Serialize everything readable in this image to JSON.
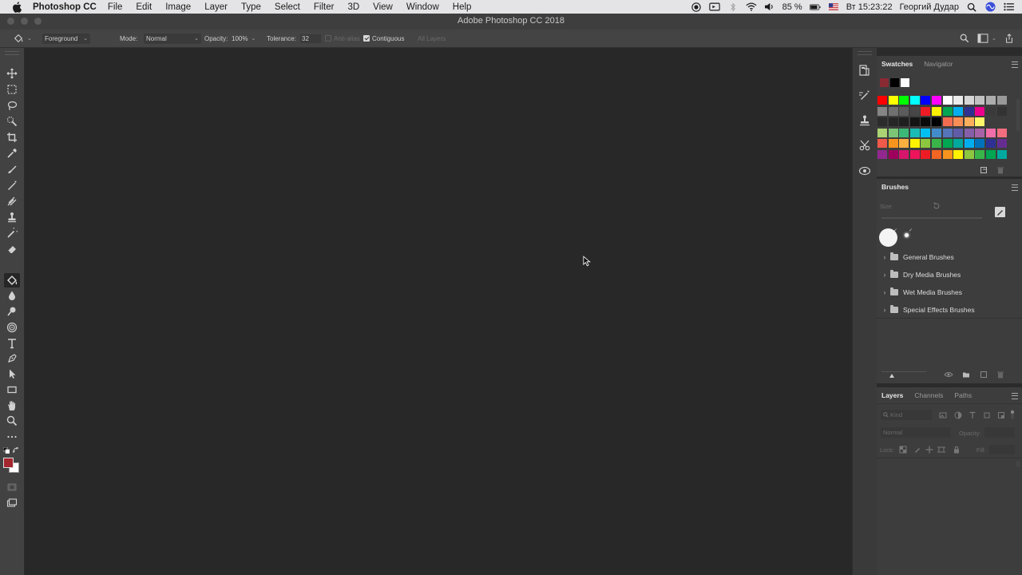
{
  "menubar": {
    "app_name": "Photoshop CC",
    "items": [
      "File",
      "Edit",
      "Image",
      "Layer",
      "Type",
      "Select",
      "Filter",
      "3D",
      "View",
      "Window",
      "Help"
    ],
    "battery": "85 %",
    "clock": "Вт 15:23:22",
    "user": "Георгий Дудар"
  },
  "window": {
    "title": "Adobe Photoshop CC 2018"
  },
  "options": {
    "fill_source": "Foreground",
    "mode_label": "Mode:",
    "mode_value": "Normal",
    "opacity_label": "Opacity:",
    "opacity_value": "100%",
    "tolerance_label": "Tolerance:",
    "tolerance_value": "32",
    "anti_alias_label": "Anti-alias",
    "anti_alias_checked": false,
    "contiguous_label": "Contiguous",
    "contiguous_checked": true,
    "all_layers_label": "All Layers"
  },
  "toolbar": {
    "tools": [
      {
        "name": "move-tool",
        "icon": "move-icon"
      },
      {
        "name": "marquee-tool",
        "icon": "rect-marquee-icon"
      },
      {
        "name": "lasso-tool",
        "icon": "lasso-icon"
      },
      {
        "name": "quick-selection-tool",
        "icon": "quick-select-icon"
      },
      {
        "name": "crop-tool",
        "icon": "crop-icon"
      },
      {
        "name": "eyedropper-tool",
        "icon": "eyedropper-icon"
      },
      {
        "name": "spot-healing-tool",
        "icon": "healing-brush-icon"
      },
      {
        "name": "brush-tool",
        "icon": "brush-icon"
      },
      {
        "name": "mixer-brush-tool",
        "icon": "mixer-brush-icon"
      },
      {
        "name": "clone-stamp-tool",
        "icon": "stamp-icon"
      },
      {
        "name": "history-brush-tool",
        "icon": "history-brush-icon"
      },
      {
        "name": "eraser-tool",
        "icon": "eraser-icon"
      },
      {
        "name": "paint-bucket-tool",
        "icon": "paint-bucket-icon",
        "active": true
      },
      {
        "name": "blur-tool",
        "icon": "blur-drop-icon"
      },
      {
        "name": "dodge-tool",
        "icon": "dodge-icon"
      },
      {
        "name": "pen-tool-group",
        "icon": "sponge-icon"
      },
      {
        "name": "type-tool",
        "icon": "type-icon"
      },
      {
        "name": "pen-tool",
        "icon": "pen-icon"
      },
      {
        "name": "path-selection-tool",
        "icon": "path-select-icon"
      },
      {
        "name": "rectangle-tool",
        "icon": "rectangle-icon"
      },
      {
        "name": "hand-tool",
        "icon": "hand-icon"
      },
      {
        "name": "zoom-tool",
        "icon": "zoom-icon"
      },
      {
        "name": "edit-toolbar",
        "icon": "more-icon"
      }
    ],
    "foreground_color": "#a4262f",
    "background_color": "#ffffff"
  },
  "swatches": {
    "tabs": [
      "Swatches",
      "Navigator"
    ],
    "recent": [
      "#8a2a32",
      "#000000",
      "#ffffff"
    ],
    "rows": [
      [
        "#ff0000",
        "#ffff00",
        "#00ff00",
        "#00ffff",
        "#0000ff",
        "#ff00ff",
        "#ffffff",
        "#ebebeb",
        "#d6d6d6",
        "#c2c2c2",
        "#adadad",
        "#999999"
      ],
      [
        "#858585",
        "#707070",
        "#5c5c5c",
        "#474747",
        "#ed1c24",
        "#fff200",
        "#00a651",
        "#00aeef",
        "#2e3192",
        "#ec008c",
        "#3a3a3a",
        "#333333"
      ],
      [
        "#2b2b2b",
        "#262626",
        "#1f1f1f",
        "#141414",
        "#0a0a0a",
        "#000000",
        "#f26c4f",
        "#f68e56",
        "#fbaf5d",
        "#fff568",
        "#3d3d3d",
        "#3d3d3d"
      ],
      [
        "#acd373",
        "#7cc576",
        "#3bb878",
        "#1abbb4",
        "#00bff3",
        "#438ccb",
        "#5574b9",
        "#605ca8",
        "#855fa8",
        "#a763a8",
        "#f06ea9",
        "#f26d7d"
      ],
      [
        "#f1594b",
        "#f7941d",
        "#fbb040",
        "#fff200",
        "#8dc63f",
        "#39b54a",
        "#00a651",
        "#00a99d",
        "#00aeef",
        "#0072bc",
        "#2e3192",
        "#662d91"
      ],
      [
        "#92278f",
        "#9e005d",
        "#d7156b",
        "#ed145b",
        "#ed1c24",
        "#f26522",
        "#f7941d",
        "#fff200",
        "#8dc63f",
        "#39b54a",
        "#00a651",
        "#00a99d"
      ]
    ]
  },
  "brushes": {
    "title": "Brushes",
    "size_label": "Size:",
    "folders": [
      "General Brushes",
      "Dry Media Brushes",
      "Wet Media Brushes",
      "Special Effects Brushes"
    ]
  },
  "layers": {
    "tabs": [
      "Layers",
      "Channels",
      "Paths"
    ],
    "kind_label": "Kind",
    "blend_mode": "Normal",
    "opacity_label": "Opacity:",
    "lock_label": "Lock:",
    "fill_label": "Fill:"
  }
}
